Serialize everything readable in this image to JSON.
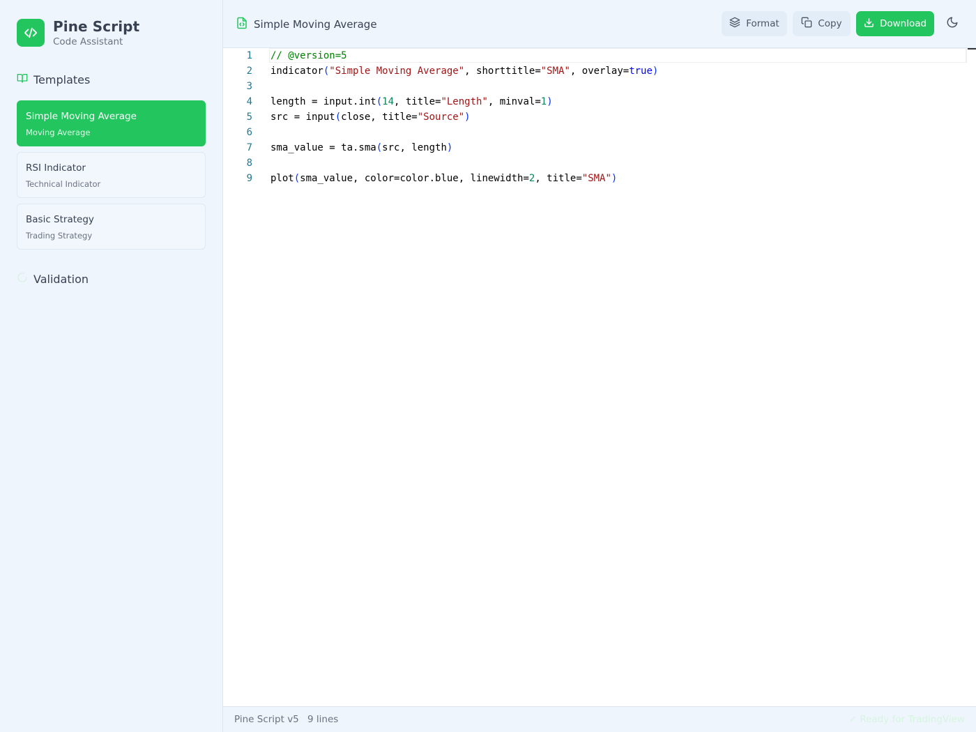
{
  "app": {
    "title": "Pine Script",
    "subtitle": "Code Assistant",
    "logo_icon": "code-brackets-icon",
    "accent_color": "#22c55e"
  },
  "sidebar": {
    "templates_heading": "Templates",
    "templates": [
      {
        "name": "Simple Moving Average",
        "category": "Moving Average",
        "active": true
      },
      {
        "name": "RSI Indicator",
        "category": "Technical Indicator",
        "active": false
      },
      {
        "name": "Basic Strategy",
        "category": "Trading Strategy",
        "active": false
      }
    ],
    "validation_heading": "Validation"
  },
  "header": {
    "file_title": "Simple Moving Average",
    "file_icon": "code-file-icon",
    "format_label": "Format",
    "copy_label": "Copy",
    "download_label": "Download",
    "theme_icon": "moon-icon"
  },
  "editor": {
    "line_numbers": [
      "1",
      "2",
      "3",
      "4",
      "5",
      "6",
      "7",
      "8",
      "9"
    ],
    "lines": [
      [
        {
          "t": "// @version=5",
          "k": "comment"
        }
      ],
      [
        {
          "t": "indicator",
          "k": "plain"
        },
        {
          "t": "(",
          "k": "br"
        },
        {
          "t": "\"Simple Moving Average\"",
          "k": "str"
        },
        {
          "t": ", shorttitle=",
          "k": "plain"
        },
        {
          "t": "\"SMA\"",
          "k": "str"
        },
        {
          "t": ", overlay=",
          "k": "plain"
        },
        {
          "t": "true",
          "k": "kw"
        },
        {
          "t": ")",
          "k": "br"
        }
      ],
      [],
      [
        {
          "t": "length = input.int",
          "k": "plain"
        },
        {
          "t": "(",
          "k": "br"
        },
        {
          "t": "14",
          "k": "num"
        },
        {
          "t": ", title=",
          "k": "plain"
        },
        {
          "t": "\"Length\"",
          "k": "str"
        },
        {
          "t": ", minval=",
          "k": "plain"
        },
        {
          "t": "1",
          "k": "num"
        },
        {
          "t": ")",
          "k": "br"
        }
      ],
      [
        {
          "t": "src = input",
          "k": "plain"
        },
        {
          "t": "(",
          "k": "br"
        },
        {
          "t": "close, title=",
          "k": "plain"
        },
        {
          "t": "\"Source\"",
          "k": "str"
        },
        {
          "t": ")",
          "k": "br"
        }
      ],
      [],
      [
        {
          "t": "sma_value = ta.sma",
          "k": "plain"
        },
        {
          "t": "(",
          "k": "br"
        },
        {
          "t": "src, length",
          "k": "plain"
        },
        {
          "t": ")",
          "k": "br"
        }
      ],
      [],
      [
        {
          "t": "plot",
          "k": "plain"
        },
        {
          "t": "(",
          "k": "br"
        },
        {
          "t": "sma_value, color=color.blue, linewidth=",
          "k": "plain"
        },
        {
          "t": "2",
          "k": "num"
        },
        {
          "t": ", title=",
          "k": "plain"
        },
        {
          "t": "\"SMA\"",
          "k": "str"
        },
        {
          "t": ")",
          "k": "br"
        }
      ]
    ]
  },
  "status": {
    "language": "Pine Script v5",
    "line_count": "9 lines",
    "ready": "✓ Ready for TradingView"
  }
}
